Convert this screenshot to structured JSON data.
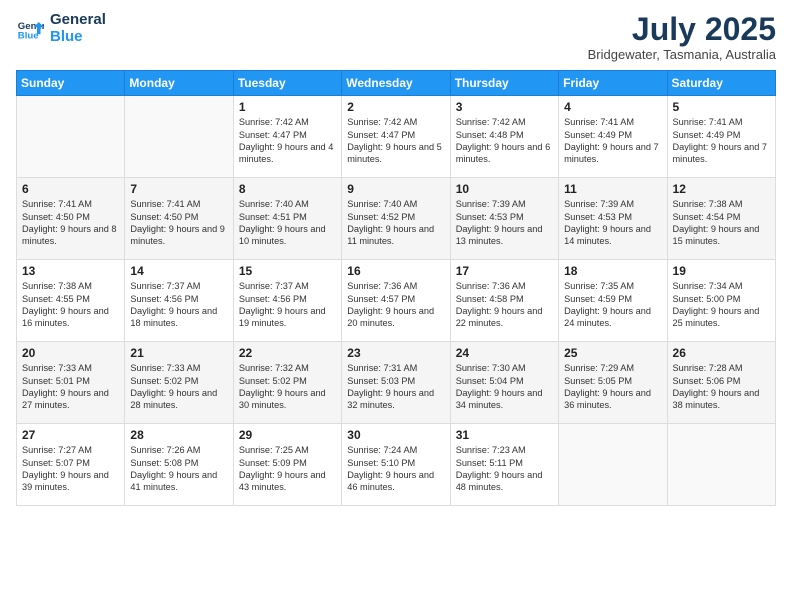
{
  "logo": {
    "line1": "General",
    "line2": "Blue"
  },
  "title": "July 2025",
  "location": "Bridgewater, Tasmania, Australia",
  "weekdays": [
    "Sunday",
    "Monday",
    "Tuesday",
    "Wednesday",
    "Thursday",
    "Friday",
    "Saturday"
  ],
  "weeks": [
    [
      {
        "day": "",
        "sunrise": "",
        "sunset": "",
        "daylight": ""
      },
      {
        "day": "",
        "sunrise": "",
        "sunset": "",
        "daylight": ""
      },
      {
        "day": "1",
        "sunrise": "Sunrise: 7:42 AM",
        "sunset": "Sunset: 4:47 PM",
        "daylight": "Daylight: 9 hours and 4 minutes."
      },
      {
        "day": "2",
        "sunrise": "Sunrise: 7:42 AM",
        "sunset": "Sunset: 4:47 PM",
        "daylight": "Daylight: 9 hours and 5 minutes."
      },
      {
        "day": "3",
        "sunrise": "Sunrise: 7:42 AM",
        "sunset": "Sunset: 4:48 PM",
        "daylight": "Daylight: 9 hours and 6 minutes."
      },
      {
        "day": "4",
        "sunrise": "Sunrise: 7:41 AM",
        "sunset": "Sunset: 4:49 PM",
        "daylight": "Daylight: 9 hours and 7 minutes."
      },
      {
        "day": "5",
        "sunrise": "Sunrise: 7:41 AM",
        "sunset": "Sunset: 4:49 PM",
        "daylight": "Daylight: 9 hours and 7 minutes."
      }
    ],
    [
      {
        "day": "6",
        "sunrise": "Sunrise: 7:41 AM",
        "sunset": "Sunset: 4:50 PM",
        "daylight": "Daylight: 9 hours and 8 minutes."
      },
      {
        "day": "7",
        "sunrise": "Sunrise: 7:41 AM",
        "sunset": "Sunset: 4:50 PM",
        "daylight": "Daylight: 9 hours and 9 minutes."
      },
      {
        "day": "8",
        "sunrise": "Sunrise: 7:40 AM",
        "sunset": "Sunset: 4:51 PM",
        "daylight": "Daylight: 9 hours and 10 minutes."
      },
      {
        "day": "9",
        "sunrise": "Sunrise: 7:40 AM",
        "sunset": "Sunset: 4:52 PM",
        "daylight": "Daylight: 9 hours and 11 minutes."
      },
      {
        "day": "10",
        "sunrise": "Sunrise: 7:39 AM",
        "sunset": "Sunset: 4:53 PM",
        "daylight": "Daylight: 9 hours and 13 minutes."
      },
      {
        "day": "11",
        "sunrise": "Sunrise: 7:39 AM",
        "sunset": "Sunset: 4:53 PM",
        "daylight": "Daylight: 9 hours and 14 minutes."
      },
      {
        "day": "12",
        "sunrise": "Sunrise: 7:38 AM",
        "sunset": "Sunset: 4:54 PM",
        "daylight": "Daylight: 9 hours and 15 minutes."
      }
    ],
    [
      {
        "day": "13",
        "sunrise": "Sunrise: 7:38 AM",
        "sunset": "Sunset: 4:55 PM",
        "daylight": "Daylight: 9 hours and 16 minutes."
      },
      {
        "day": "14",
        "sunrise": "Sunrise: 7:37 AM",
        "sunset": "Sunset: 4:56 PM",
        "daylight": "Daylight: 9 hours and 18 minutes."
      },
      {
        "day": "15",
        "sunrise": "Sunrise: 7:37 AM",
        "sunset": "Sunset: 4:56 PM",
        "daylight": "Daylight: 9 hours and 19 minutes."
      },
      {
        "day": "16",
        "sunrise": "Sunrise: 7:36 AM",
        "sunset": "Sunset: 4:57 PM",
        "daylight": "Daylight: 9 hours and 20 minutes."
      },
      {
        "day": "17",
        "sunrise": "Sunrise: 7:36 AM",
        "sunset": "Sunset: 4:58 PM",
        "daylight": "Daylight: 9 hours and 22 minutes."
      },
      {
        "day": "18",
        "sunrise": "Sunrise: 7:35 AM",
        "sunset": "Sunset: 4:59 PM",
        "daylight": "Daylight: 9 hours and 24 minutes."
      },
      {
        "day": "19",
        "sunrise": "Sunrise: 7:34 AM",
        "sunset": "Sunset: 5:00 PM",
        "daylight": "Daylight: 9 hours and 25 minutes."
      }
    ],
    [
      {
        "day": "20",
        "sunrise": "Sunrise: 7:33 AM",
        "sunset": "Sunset: 5:01 PM",
        "daylight": "Daylight: 9 hours and 27 minutes."
      },
      {
        "day": "21",
        "sunrise": "Sunrise: 7:33 AM",
        "sunset": "Sunset: 5:02 PM",
        "daylight": "Daylight: 9 hours and 28 minutes."
      },
      {
        "day": "22",
        "sunrise": "Sunrise: 7:32 AM",
        "sunset": "Sunset: 5:02 PM",
        "daylight": "Daylight: 9 hours and 30 minutes."
      },
      {
        "day": "23",
        "sunrise": "Sunrise: 7:31 AM",
        "sunset": "Sunset: 5:03 PM",
        "daylight": "Daylight: 9 hours and 32 minutes."
      },
      {
        "day": "24",
        "sunrise": "Sunrise: 7:30 AM",
        "sunset": "Sunset: 5:04 PM",
        "daylight": "Daylight: 9 hours and 34 minutes."
      },
      {
        "day": "25",
        "sunrise": "Sunrise: 7:29 AM",
        "sunset": "Sunset: 5:05 PM",
        "daylight": "Daylight: 9 hours and 36 minutes."
      },
      {
        "day": "26",
        "sunrise": "Sunrise: 7:28 AM",
        "sunset": "Sunset: 5:06 PM",
        "daylight": "Daylight: 9 hours and 38 minutes."
      }
    ],
    [
      {
        "day": "27",
        "sunrise": "Sunrise: 7:27 AM",
        "sunset": "Sunset: 5:07 PM",
        "daylight": "Daylight: 9 hours and 39 minutes."
      },
      {
        "day": "28",
        "sunrise": "Sunrise: 7:26 AM",
        "sunset": "Sunset: 5:08 PM",
        "daylight": "Daylight: 9 hours and 41 minutes."
      },
      {
        "day": "29",
        "sunrise": "Sunrise: 7:25 AM",
        "sunset": "Sunset: 5:09 PM",
        "daylight": "Daylight: 9 hours and 43 minutes."
      },
      {
        "day": "30",
        "sunrise": "Sunrise: 7:24 AM",
        "sunset": "Sunset: 5:10 PM",
        "daylight": "Daylight: 9 hours and 46 minutes."
      },
      {
        "day": "31",
        "sunrise": "Sunrise: 7:23 AM",
        "sunset": "Sunset: 5:11 PM",
        "daylight": "Daylight: 9 hours and 48 minutes."
      },
      {
        "day": "",
        "sunrise": "",
        "sunset": "",
        "daylight": ""
      },
      {
        "day": "",
        "sunrise": "",
        "sunset": "",
        "daylight": ""
      }
    ]
  ]
}
